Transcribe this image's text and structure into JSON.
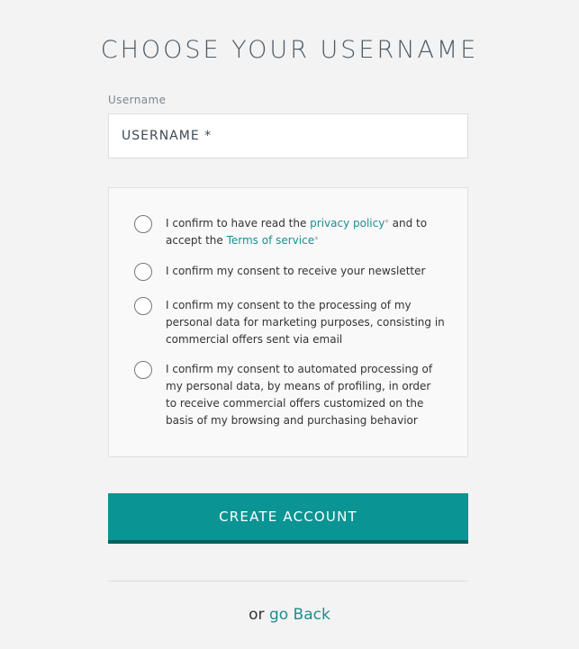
{
  "title": "CHOOSE YOUR USERNAME",
  "username": {
    "label": "Username",
    "placeholder": "USERNAME *"
  },
  "consents": {
    "privacy_prefix": "I confirm to have read the ",
    "privacy_link": "privacy policy",
    "privacy_middle": " and to accept the ",
    "terms_link": "Terms of service",
    "required_mark": "*",
    "newsletter": "I confirm my consent to receive your newsletter",
    "marketing": "I confirm my consent to the processing of my personal data for marketing purposes, consisting in commercial offers sent via email",
    "profiling": "I confirm my consent to automated processing of my personal data, by means of profiling, in order to receive commercial offers customized on the basis of my browsing and purchasing behavior"
  },
  "create_button": "CREATE ACCOUNT",
  "footer": {
    "prefix": "or",
    "back_link": "go Back"
  },
  "colors": {
    "accent": "#0a9494",
    "accent_dark": "#036060",
    "link": "#1d8d90",
    "background": "#f3f3f3"
  },
  "icons": {
    "radio": "radio-unchecked-icon"
  }
}
